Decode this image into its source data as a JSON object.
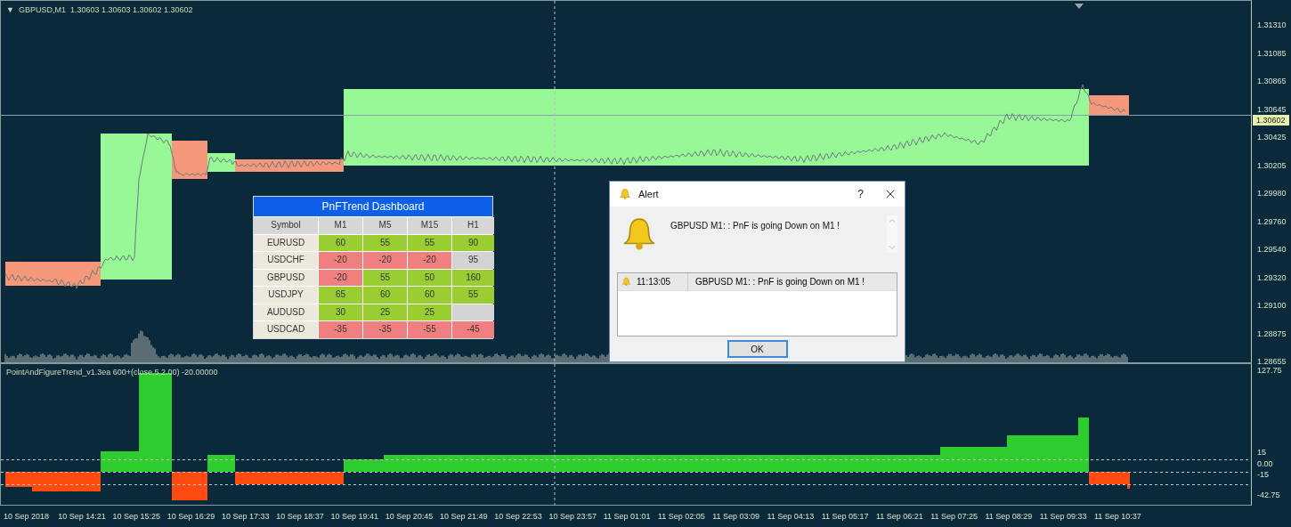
{
  "chart": {
    "menu_glyph": "▼",
    "symbol": "GBPUSD,M1",
    "quotes": "1.30603 1.30603 1.30602 1.30602",
    "current_price": "1.30602",
    "price_axis": [
      "1.31310",
      "1.31085",
      "1.30865",
      "1.30645",
      "1.30425",
      "1.30205",
      "1.29980",
      "1.29760",
      "1.29540",
      "1.29320",
      "1.29100",
      "1.28875",
      "1.28655"
    ],
    "time_axis": [
      "10 Sep 2018",
      "10 Sep 14:21",
      "10 Sep 15:25",
      "10 Sep 16:29",
      "10 Sep 17:33",
      "10 Sep 18:37",
      "10 Sep 19:41",
      "10 Sep 20:45",
      "10 Sep 21:49",
      "10 Sep 22:53",
      "10 Sep 23:57",
      "11 Sep 01:01",
      "11 Sep 02:05",
      "11 Sep 03:09",
      "11 Sep 04:13",
      "11 Sep 05:17",
      "11 Sep 06:21",
      "11 Sep 07:25",
      "11 Sep 08:29",
      "11 Sep 09:33",
      "11 Sep 10:37"
    ]
  },
  "indicator": {
    "label": "PointAndFigureTrend_v1.3ea 600+(close,5,2.00) -20.00000",
    "axis": [
      "127.75",
      "15",
      "0.00",
      "-15",
      "-42.75"
    ]
  },
  "dashboard": {
    "title": "PnFTrend Dashboard",
    "columns": [
      "Symbol",
      "M1",
      "M5",
      "M15",
      "H1"
    ],
    "rows": [
      {
        "cells": [
          {
            "value": "EURUSD"
          },
          {
            "value": "60",
            "color": "#9acd32"
          },
          {
            "value": "55",
            "color": "#9acd32"
          },
          {
            "value": "55",
            "color": "#9acd32"
          },
          {
            "value": "90",
            "color": "#9acd32"
          }
        ]
      },
      {
        "cells": [
          {
            "value": "USDCHF"
          },
          {
            "value": "-20",
            "color": "#f08080"
          },
          {
            "value": "-20",
            "color": "#f08080"
          },
          {
            "value": "-20",
            "color": "#f08080"
          },
          {
            "value": "95",
            "color": "#d3d3d3"
          }
        ]
      },
      {
        "cells": [
          {
            "value": "GBPUSD"
          },
          {
            "value": "-20",
            "color": "#f08080"
          },
          {
            "value": "55",
            "color": "#9acd32"
          },
          {
            "value": "50",
            "color": "#9acd32"
          },
          {
            "value": "160",
            "color": "#9acd32"
          }
        ]
      },
      {
        "cells": [
          {
            "value": "USDJPY"
          },
          {
            "value": "65",
            "color": "#9acd32"
          },
          {
            "value": "60",
            "color": "#9acd32"
          },
          {
            "value": "60",
            "color": "#9acd32"
          },
          {
            "value": "55",
            "color": "#9acd32"
          }
        ]
      },
      {
        "cells": [
          {
            "value": "AUDUSD"
          },
          {
            "value": "30",
            "color": "#9acd32"
          },
          {
            "value": "25",
            "color": "#9acd32"
          },
          {
            "value": "25",
            "color": "#9acd32"
          },
          {
            "color": "#d3d3d3"
          }
        ]
      },
      {
        "cells": [
          {
            "value": "USDCAD"
          },
          {
            "value": "-35",
            "color": "#f08080"
          },
          {
            "value": "-35",
            "color": "#f08080"
          },
          {
            "value": "-55",
            "color": "#f08080"
          },
          {
            "value": "-45",
            "color": "#f08080"
          }
        ]
      }
    ]
  },
  "alert": {
    "title": "Alert",
    "help": "?",
    "message": "GBPUSD M1: : PnF is going Down on M1 !",
    "log": [
      {
        "time": "11:13:05",
        "message": "GBPUSD M1: : PnF is going Down on M1 !",
        "selected": true
      }
    ],
    "ok": "OK"
  }
}
